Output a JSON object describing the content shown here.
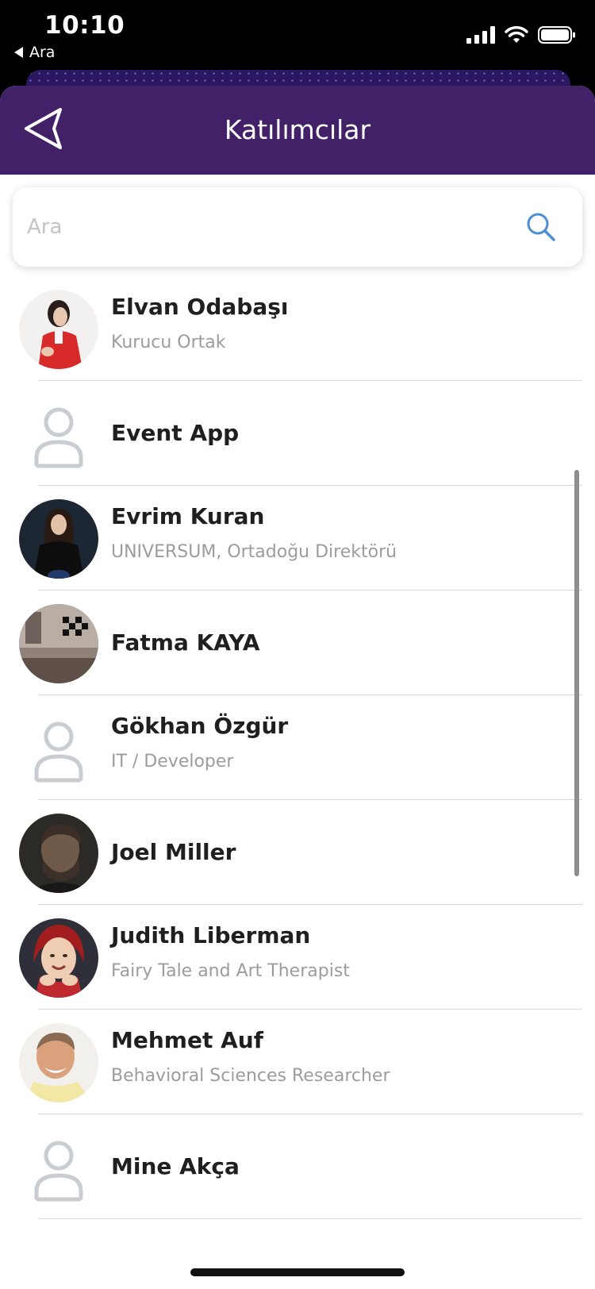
{
  "status_bar": {
    "time": "10:10",
    "back_app": "Ara"
  },
  "header": {
    "title": "Katılımcılar"
  },
  "search": {
    "placeholder": "Ara"
  },
  "participants": [
    {
      "name": "Elvan Odabaşı",
      "title": "Kurucu Ortak"
    },
    {
      "name": "Event App",
      "title": ""
    },
    {
      "name": "Evrim Kuran",
      "title": "UNIVERSUM, Ortadoğu Direktörü"
    },
    {
      "name": "Fatma KAYA",
      "title": ""
    },
    {
      "name": "Gökhan Özgür",
      "title": "IT / Developer"
    },
    {
      "name": "Joel Miller",
      "title": ""
    },
    {
      "name": "Judith Liberman",
      "title": "Fairy Tale and Art Therapist"
    },
    {
      "name": "Mehmet Auf",
      "title": "Behavioral Sciences Researcher"
    },
    {
      "name": "Mine Akça",
      "title": ""
    }
  ],
  "colors": {
    "header_bg": "#432168",
    "search_icon": "#4d8fd6"
  }
}
